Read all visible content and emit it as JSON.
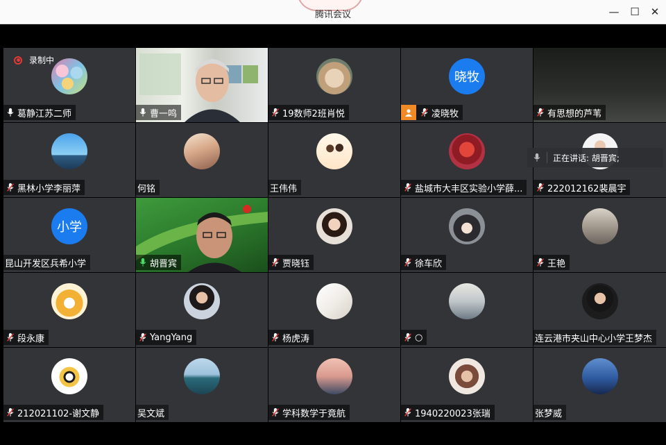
{
  "window": {
    "title": "腾讯会议",
    "minimize_label": "—",
    "maximize_label": "☐",
    "close_label": "✕"
  },
  "recording": {
    "label": "录制中"
  },
  "speaking": {
    "label": "正在讲话: 胡晋宾;"
  },
  "colors": {
    "mic_muted": "#ffffff",
    "mic_active": "#4cd964",
    "host_badge": "#f08a27",
    "avatar_text_bg": "#1b7cf0",
    "recording_dot": "#e53935"
  },
  "participants": [
    {
      "name": "葛静江苏二师",
      "mic": "on",
      "avatar": "macarons"
    },
    {
      "name": "曹一鸣",
      "mic": "on",
      "avatar": "video-man-glasses"
    },
    {
      "name": "19数师2班肖悦",
      "mic": "muted",
      "avatar": "fox-plush"
    },
    {
      "name": "凌晓牧",
      "mic": "muted",
      "host": true,
      "avatar_text": "晓牧"
    },
    {
      "name": "有思想的芦苇",
      "mic": "muted",
      "avatar": "dark-video"
    },
    {
      "name": "黑林小学李丽萍",
      "mic": "muted",
      "avatar": "blue-sky"
    },
    {
      "name": "何铭",
      "mic": "none",
      "avatar": "building"
    },
    {
      "name": "王伟伟",
      "mic": "none",
      "avatar": "cartoon-couple"
    },
    {
      "name": "盐城市大丰区实验小学薛...",
      "mic": "muted",
      "avatar": "cartoon-red"
    },
    {
      "name": "222012162裴晨宇",
      "mic": "muted",
      "avatar": "person"
    },
    {
      "name": "昆山开发区兵希小学",
      "mic": "none",
      "avatar_text": "小学"
    },
    {
      "name": "胡晋宾",
      "mic": "active",
      "avatar": "video-leaf"
    },
    {
      "name": "贾晓钰",
      "mic": "muted",
      "avatar": "girl"
    },
    {
      "name": "徐车欣",
      "mic": "muted",
      "avatar": "anime-boy"
    },
    {
      "name": "王艳",
      "mic": "muted",
      "avatar": "statue"
    },
    {
      "name": "段永康",
      "mic": "muted",
      "avatar": "shiba"
    },
    {
      "name": "YangYang",
      "mic": "muted",
      "avatar": "woman"
    },
    {
      "name": "杨虎涛",
      "mic": "muted",
      "avatar": "sketch"
    },
    {
      "name": "○",
      "mic": "muted",
      "avatar": "painting"
    },
    {
      "name": "连云港市夹山中心小学王梦杰",
      "mic": "none",
      "avatar": "young-man"
    },
    {
      "name": "212021102-谢文静",
      "mic": "muted",
      "avatar": "cartoon-bee"
    },
    {
      "name": "吴文斌",
      "mic": "none",
      "avatar": "sea"
    },
    {
      "name": "学科数学于竟航",
      "mic": "muted",
      "avatar": "sunset"
    },
    {
      "name": "1940220023张瑞",
      "mic": "muted",
      "avatar": "woman-old"
    },
    {
      "name": "张梦威",
      "mic": "none",
      "avatar": "blue-silhouette"
    }
  ]
}
